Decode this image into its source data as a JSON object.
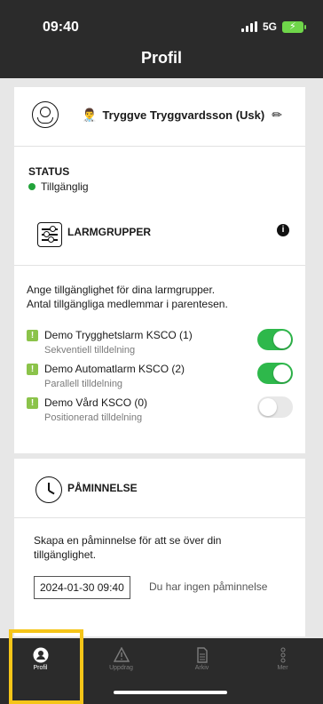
{
  "status_bar": {
    "time": "09:40",
    "network": "5G"
  },
  "header": {
    "title": "Profil"
  },
  "profile": {
    "name": "Tryggve Tryggvardsson (Usk)",
    "status_label": "STATUS",
    "status_value": "Tillgänglig",
    "status_color": "#22a33a"
  },
  "alarm": {
    "title": "LARMGRUPPER",
    "description_line1": "Ange tillgänglighet för dina larmgrupper.",
    "description_line2": "Antal tillgängliga medlemmar i parentesen.",
    "groups": [
      {
        "name": "Demo Trygghetslarm KSCO (1)",
        "mode": "Sekventiell tilldelning",
        "enabled": true
      },
      {
        "name": "Demo Automatlarm KSCO (2)",
        "mode": "Parallell tilldelning",
        "enabled": true
      },
      {
        "name": "Demo Vård KSCO (0)",
        "mode": "Positionerad tilldelning",
        "enabled": false
      }
    ]
  },
  "reminder": {
    "title": "PÅMINNELSE",
    "description_line1": "Skapa en påminnelse för att se över din",
    "description_line2": "tillgänglighet.",
    "datetime": "2024-01-30 09:40",
    "none_text": "Du har ingen påminnelse"
  },
  "tabs": [
    {
      "label": "Profil",
      "icon": "profile-icon",
      "active": true
    },
    {
      "label": "Uppdrag",
      "icon": "warning-icon",
      "active": false
    },
    {
      "label": "Arkiv",
      "icon": "document-icon",
      "active": false
    },
    {
      "label": "Mer",
      "icon": "more-icon",
      "active": false
    }
  ],
  "colors": {
    "accent": "#2eb84b",
    "highlight": "#f5c518",
    "dark": "#2b2b2b"
  }
}
